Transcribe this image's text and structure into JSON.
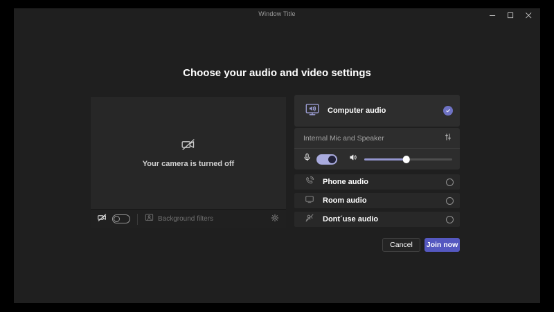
{
  "window": {
    "title": "Window Title",
    "controls": {
      "minimize": "minimize",
      "maximize": "maximize",
      "close": "close"
    }
  },
  "heading": "Choose your audio and video settings",
  "camera_panel": {
    "status_text": "Your camera is turned off",
    "camera_toggle_state": "off",
    "background_filters_label": "Background filters",
    "icons": [
      "camera-off-icon",
      "background-filters-icon",
      "gear-icon"
    ]
  },
  "audio": {
    "computer": {
      "label": "Computer audio",
      "selected": true,
      "icon": "computer-audio-icon"
    },
    "device": {
      "name": "Internal Mic and Speaker",
      "settings_icon": "sliders-icon",
      "mic_toggle_state": "on",
      "volume_percent": 48,
      "icons": [
        "mic-icon",
        "speaker-icon"
      ]
    },
    "phone": {
      "label": "Phone audio",
      "selected": false,
      "icon": "phone-audio-icon"
    },
    "room": {
      "label": "Room audio",
      "selected": false,
      "icon": "room-audio-icon"
    },
    "none": {
      "label": "Dont´use audio",
      "selected": false,
      "icon": "no-audio-icon"
    }
  },
  "footer": {
    "cancel": "Cancel",
    "join": "Join now"
  },
  "colors": {
    "window_bg": "#1f1f1f",
    "card_bg": "#2d2d2d",
    "accent_purple": "#5558c0",
    "toggle_on_track": "#a9abde",
    "selected_check": "#6e72c3",
    "computer_audio_icon": "#9b9dd3"
  }
}
